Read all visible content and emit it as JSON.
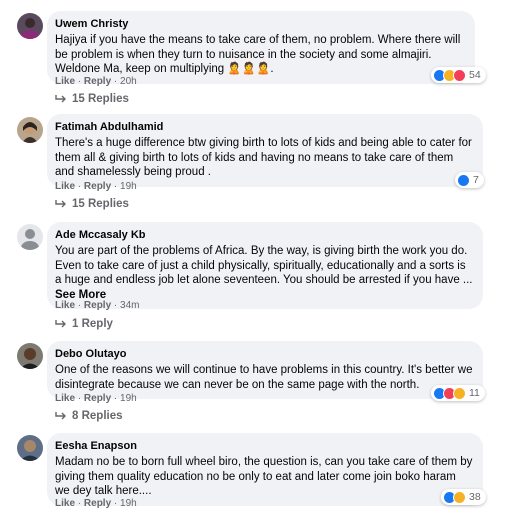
{
  "comments": [
    {
      "author": "Uwem Christy",
      "text": "Hajiya if you have the means to take care of them, no problem. Where there will be problem is when they turn to nuisance in the society and some almajiri. Weldone Ma, keep on multiplying 🙎🙎🙎.",
      "like": "Like",
      "reply": "Reply",
      "time": "20h",
      "reaction_count": "54",
      "replies": "15 Replies"
    },
    {
      "author": "Fatimah Abdulhamid",
      "text": "There's a huge difference btw giving birth to lots of kids and being able to cater for them all & giving birth to lots of kids and having no means to take care of them and shamelessly being proud .",
      "like": "Like",
      "reply": "Reply",
      "time": "19h",
      "reaction_count": "7",
      "replies": "15 Replies"
    },
    {
      "author": "Ade Mccasaly Kb",
      "text": "You are part of the problems of Africa. By the way, is giving birth the work you do. Even to take care of just a child physically, spiritually, educationally and a sorts is a huge and endless job let alone seventeen. You should be arrested if you have ...",
      "see_more": "See More",
      "like": "Like",
      "reply": "Reply",
      "time": "34m",
      "replies": "1 Reply"
    },
    {
      "author": "Debo Olutayo",
      "text": "One of the reasons we will continue to have problems in this country. It's better we disintegrate because we can never be on the same page with the north.",
      "like": "Like",
      "reply": "Reply",
      "time": "19h",
      "reaction_count": "11",
      "replies": "8 Replies"
    },
    {
      "author": "Eesha Enapson",
      "text": "Madam no be to born full wheel biro, the question is, can you take care of them by giving them quality education no be only to eat and later come join boko haram we dey talk here....",
      "like": "Like",
      "reply": "Reply",
      "time": "19h",
      "reaction_count": "38"
    }
  ],
  "colors": {
    "bubble": "#f0f2f5",
    "secondary_text": "#65676b",
    "like_blue": "#1877f2",
    "haha_yellow": "#f7b125",
    "love_red": "#f33e58"
  }
}
